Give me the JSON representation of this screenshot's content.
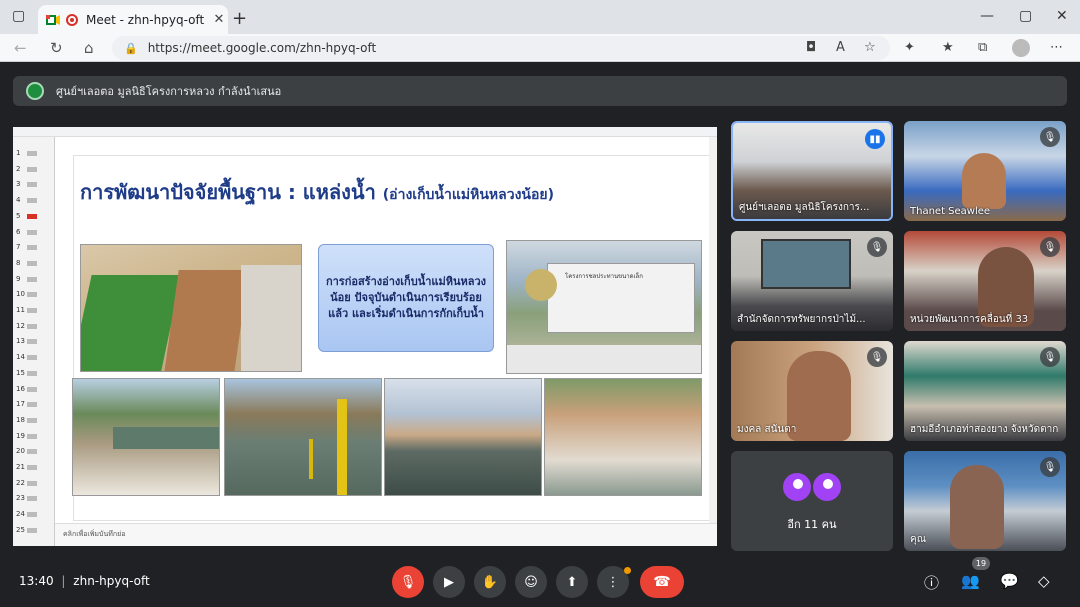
{
  "browser": {
    "tab_title": "Meet - zhn-hpyq-oft",
    "url": "https://meet.google.com/zhn-hpyq-oft"
  },
  "banner": {
    "presenter": "ศูนย์ฯเลอตอ มูลนิธิโครงการหลวง กำลังนำเสนอ"
  },
  "slide": {
    "title": "การพัฒนาปัจจัยพื้นฐาน : แหล่งน้ำ",
    "title_sub": "(อ่างเก็บน้ำแม่หินหลวงน้อย)",
    "callout": "การก่อสร้างอ่างเก็บน้ำแม่หินหลวงน้อย ปัจจุบันดำเนินการเรียบร้อยแล้ว และเริ่มดำเนินการกักเก็บน้ำ",
    "sign_text": "โครงการชลประทานขนาดเล็ก",
    "notes": "คลิกเพื่อเพิ่มบันทึกย่อ",
    "thumb_numbers": [
      "1",
      "2",
      "3",
      "4",
      "5",
      "6",
      "7",
      "8",
      "9",
      "10",
      "11",
      "12",
      "13",
      "14",
      "15",
      "16",
      "17",
      "18",
      "19",
      "20",
      "21",
      "22",
      "23",
      "24",
      "25"
    ]
  },
  "participants": [
    {
      "name": "ศูนย์ฯเลอตอ มูลนิธิโครงการ...",
      "speaking": true
    },
    {
      "name": "Thanet Seawlee",
      "speaking": false
    },
    {
      "name": "สำนักจัดการทรัพยากรป่าไม้...",
      "speaking": false
    },
    {
      "name": "หน่วยพัฒนาการคลื่อนที่ 33",
      "speaking": false
    },
    {
      "name": "มงคล สนันตา",
      "speaking": false
    },
    {
      "name": "ฮามอีอำเภอท่าสองยาง จังหวัดตาก",
      "speaking": false
    },
    {
      "name": "คุณ",
      "speaking": false
    }
  ],
  "others": {
    "label": "อีก 11 คน"
  },
  "bottombar": {
    "time": "13:40",
    "meeting_code": "zhn-hpyq-oft",
    "participant_count": "19"
  },
  "colors": {
    "accent": "#8ab4f8",
    "danger": "#ea4335",
    "bg": "#202124"
  }
}
